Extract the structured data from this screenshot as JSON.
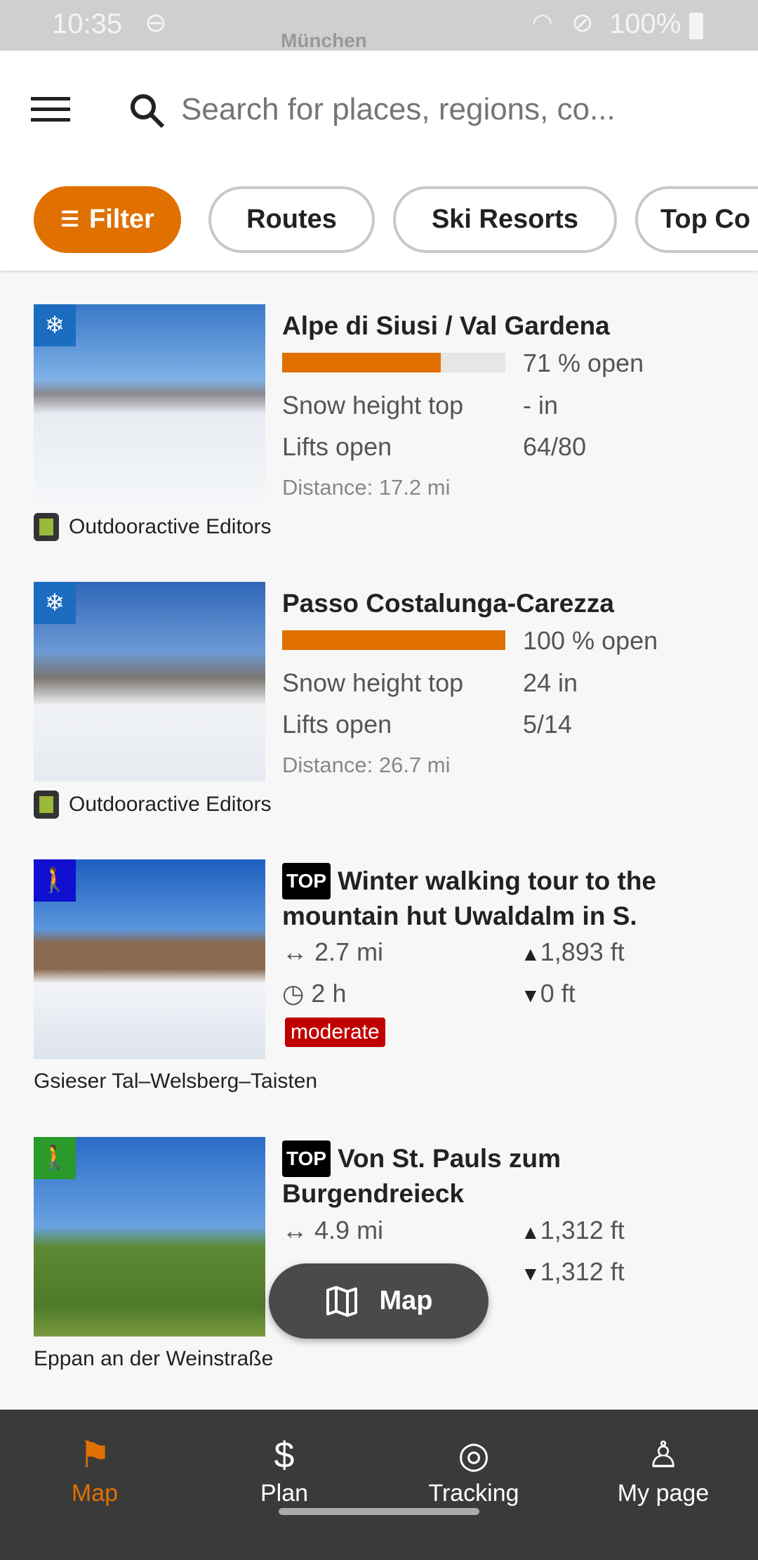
{
  "status_bar": {
    "time": "10:35",
    "battery": "100%",
    "map_label": "München"
  },
  "header": {
    "search_placeholder": "Search for places, regions, co..."
  },
  "chips": [
    {
      "label": "Filter",
      "active": true
    },
    {
      "label": "Routes"
    },
    {
      "label": "Ski Resorts"
    },
    {
      "label": "Top Co"
    }
  ],
  "accent_color": "#e07000",
  "results": [
    {
      "type": "ski-resort",
      "title": "Alpe di Siusi / Val Gardena",
      "open_percent": 71,
      "open_label": "71 % open",
      "snow_label": "Snow height top",
      "snow_value": "- in",
      "lifts_label": "Lifts open",
      "lifts_value": "64/80",
      "distance": "Distance: 17.2 mi",
      "author": "Outdooractive Editors"
    },
    {
      "type": "ski-resort",
      "title": "Passo Costalunga-Carezza",
      "open_percent": 100,
      "open_label": "100 % open",
      "snow_label": "Snow height top",
      "snow_value": "24 in",
      "lifts_label": "Lifts open",
      "lifts_value": "5/14",
      "distance": "Distance: 26.7 mi",
      "author": "Outdooractive Editors"
    },
    {
      "type": "winter-hiking",
      "top": "TOP",
      "title": "Winter walking tour to the mountain hut Uwaldalm in S.",
      "length": "2.7 mi",
      "duration": "2 h",
      "ascent": "1,893 ft",
      "descent": "0 ft",
      "difficulty": "moderate",
      "difficulty_color": "#c00000",
      "location": "Gsieser Tal–Welsberg–Taisten"
    },
    {
      "type": "hiking",
      "top": "TOP",
      "title": "Von St. Pauls zum Burgendreieck",
      "length": "4.9 mi",
      "ascent": "1,312 ft",
      "descent": "1,312 ft",
      "location": "Eppan an der Weinstraße"
    }
  ],
  "map_button": {
    "label": "Map"
  },
  "bottom_nav": [
    {
      "label": "Map",
      "active": true
    },
    {
      "label": "Plan"
    },
    {
      "label": "Tracking"
    },
    {
      "label": "My page"
    }
  ]
}
